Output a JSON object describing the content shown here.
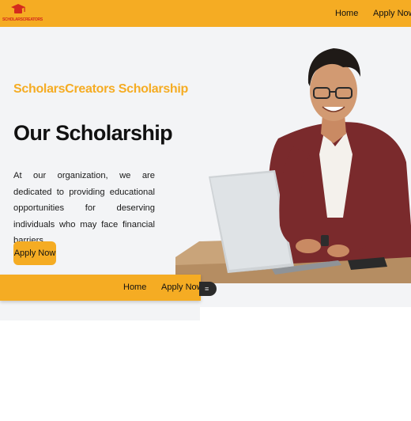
{
  "header": {
    "logo_text": "SCHOLARSCREATORS",
    "nav": {
      "home": "Home",
      "apply": "Apply Now"
    }
  },
  "hero": {
    "brand_line": "ScholarsCreators Scholarship",
    "title": "Our Scholarship",
    "description": "At our organization, we are dedicated to providing educational opportunities for deserving individuals who may face financial barriers",
    "cta_label": "Apply Now"
  },
  "secondary_nav": {
    "home": "Home",
    "apply": "Apply Now"
  },
  "toggle_icon": "≡",
  "colors": {
    "accent": "#f5ac23",
    "logo_red": "#d42b1d",
    "hero_bg": "#f3f4f6"
  }
}
